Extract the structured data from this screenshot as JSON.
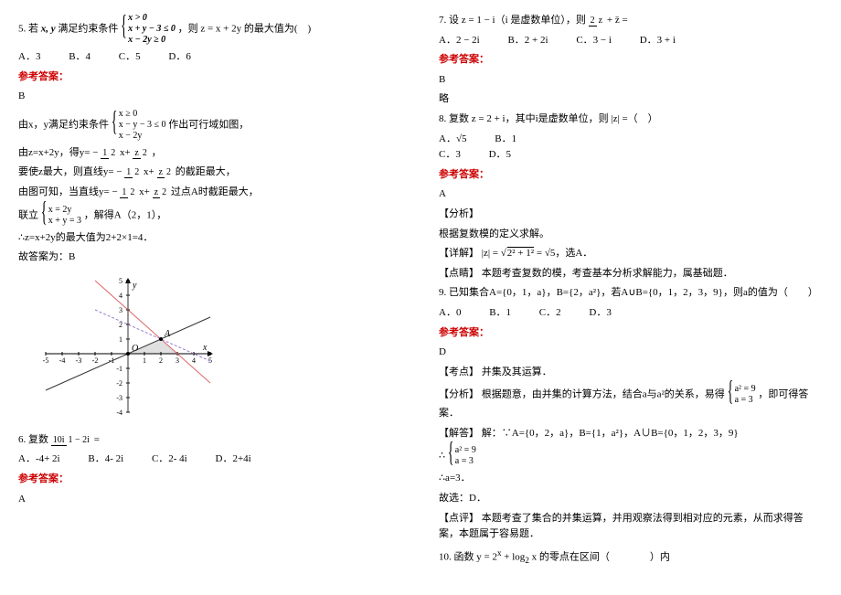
{
  "left": {
    "q5_prefix": "5. 若",
    "q5_vars": "x, y",
    "q5_mid": "满足约束条件",
    "q5_constraints": [
      "x > 0",
      "x + y − 3 ≤ 0",
      "x − 2y ≥ 0"
    ],
    "q5_tail": "，则 z = x + 2y 的最大值为(　)",
    "q5_opts": {
      "A": "A．3",
      "B": "B．4",
      "C": "C．5",
      "D": "D．6"
    },
    "ans_label": "参考答案：",
    "q5_ans": "B",
    "q5_exp1a": "由x，y满足约束条件",
    "q5_exp1_sys": [
      "x ≥ 0",
      "x − y − 3 ≤ 0",
      "x − 2y"
    ],
    "q5_exp1b": " 作出可行域如图，",
    "q5_exp2_pre": "由z=x+2y，得y= − ",
    "q5_exp2_f1n": "1",
    "q5_exp2_f1d": "2",
    "q5_exp2_mid": "x+",
    "q5_exp2_f2n": "z",
    "q5_exp2_f2d": "2",
    "q5_exp2_post": "，",
    "q5_exp3_pre": "要使z最大，则直线y= − ",
    "q5_exp3_post": "的截距最大，",
    "q5_exp4_pre": "由图可知，当直线y= − ",
    "q5_exp4_post": "过点A时截距最大，",
    "q5_exp5_pre": "联立",
    "q5_exp5_sys": [
      "x = 2y",
      "x + y = 3"
    ],
    "q5_exp5_post": "，解得A（2，1），",
    "q5_exp6": "∴z=x+2y的最大值为2+2×1=4．",
    "q5_exp7": "故答案为：B",
    "q6_pre": "6. 复数",
    "q6_fn": "10i",
    "q6_fd": "1 − 2i",
    "q6_post": " =",
    "q6_opts": {
      "A": "A．-4+ 2i",
      "B": "B．4- 2i",
      "C": "C．2- 4i",
      "D": "D．2+4i"
    },
    "q6_ans": "A"
  },
  "right": {
    "q7_pre": "7. 设 z = 1 − i（i 是虚数单位），则 ",
    "q7_fn": "2",
    "q7_fd": "z",
    "q7_mid": " + z̄ =",
    "q7_opts": {
      "A": "A．2 − 2i",
      "B": "B．2 + 2i",
      "C": "C．3 − i",
      "D": "D．3 + i"
    },
    "ans_label": "参考答案：",
    "q7_ans": "B",
    "q7_note": "略",
    "q8_line": "8. 复数 z = 2 + i，其中i是虚数单位，则 |z| =（　）",
    "q8_opts": {
      "A": "A．√5",
      "B": "B．1",
      "C": "C．3",
      "D": "D．5"
    },
    "q8_ans": "A",
    "q8_anal_label": "【分析】",
    "q8_anal": "根据复数模的定义求解。",
    "q8_det_label": "【详解】",
    "q8_det_pre": "|z| = ",
    "q8_det_sqrt": "2² + 1²",
    "q8_det_post": " = √5，选A．",
    "q8_ps_label": "【点睛】",
    "q8_ps": "本题考查复数的模，考查基本分析求解能力，属基础题．",
    "q9_line": "9. 已知集合A={0，1，a}，B={2，a²}，若A∪B={0，1，2，3，9}，则a的值为（　　）",
    "q9_opts": {
      "A": "A．0",
      "B": "B．1",
      "C": "C．2",
      "D": "D．3"
    },
    "q9_ans": "D",
    "q9_topic_label": "【考点】",
    "q9_topic": "并集及其运算．",
    "q9_anal_label": "【分析】",
    "q9_anal_pre": "根据题意，由并集的计算方法，结合a与a²的关系，易得",
    "q9_anal_sys": [
      "a² = 9",
      "a = 3"
    ],
    "q9_anal_post": "，即可得答案．",
    "q9_sol_label": "【解答】",
    "q9_sol1": "解：∵A={0，2，a}，B={1，a²}，A∪B={0，1，2，3，9}",
    "q9_sol2_pre": "∴",
    "q9_sol3": "∴a=3．",
    "q9_sol4": "故选：D．",
    "q9_ps_label": "【点评】",
    "q9_ps": "本题考查了集合的并集运算，并用观察法得到相对应的元素，从而求得答案，本题属于容易题．",
    "q10_line_pre": "10. 函数 y = 2",
    "q10_exp_sup": "x",
    "q10_line_mid": " + log",
    "q10_exp_sub": "2",
    "q10_line_post": " x 的零点在区间（　　　　）内"
  },
  "chart_data": {
    "type": "line",
    "title": "",
    "xlabel": "x",
    "ylabel": "y",
    "xlim": [
      -5,
      5
    ],
    "ylim": [
      -4,
      5
    ],
    "xticks": [
      -5,
      -4,
      -3,
      -2,
      -1,
      0,
      1,
      2,
      3,
      4,
      5
    ],
    "yticks": [
      -4,
      -3,
      -2,
      -1,
      0,
      1,
      2,
      3,
      4,
      5
    ],
    "series": [
      {
        "name": "x+y=3",
        "color": "#d66",
        "points": [
          [
            -2,
            5
          ],
          [
            5,
            -2
          ]
        ]
      },
      {
        "name": "x-2y=0",
        "color": "#333",
        "points": [
          [
            -5,
            -2.5
          ],
          [
            5,
            2.5
          ]
        ]
      },
      {
        "name": "x=0",
        "color": "#333",
        "points": [
          [
            0,
            -4
          ],
          [
            0,
            5
          ]
        ]
      },
      {
        "name": "z=x+2y optimal",
        "color": "#9a7bcc",
        "dash": true,
        "points": [
          [
            -2,
            3
          ],
          [
            5,
            -0.5
          ]
        ]
      }
    ],
    "annotations": [
      {
        "label": "A",
        "x": 2,
        "y": 1
      },
      {
        "label": "O",
        "x": 0,
        "y": 0
      }
    ],
    "shaded_region": [
      [
        0,
        0
      ],
      [
        3,
        0
      ],
      [
        2,
        1
      ]
    ]
  }
}
